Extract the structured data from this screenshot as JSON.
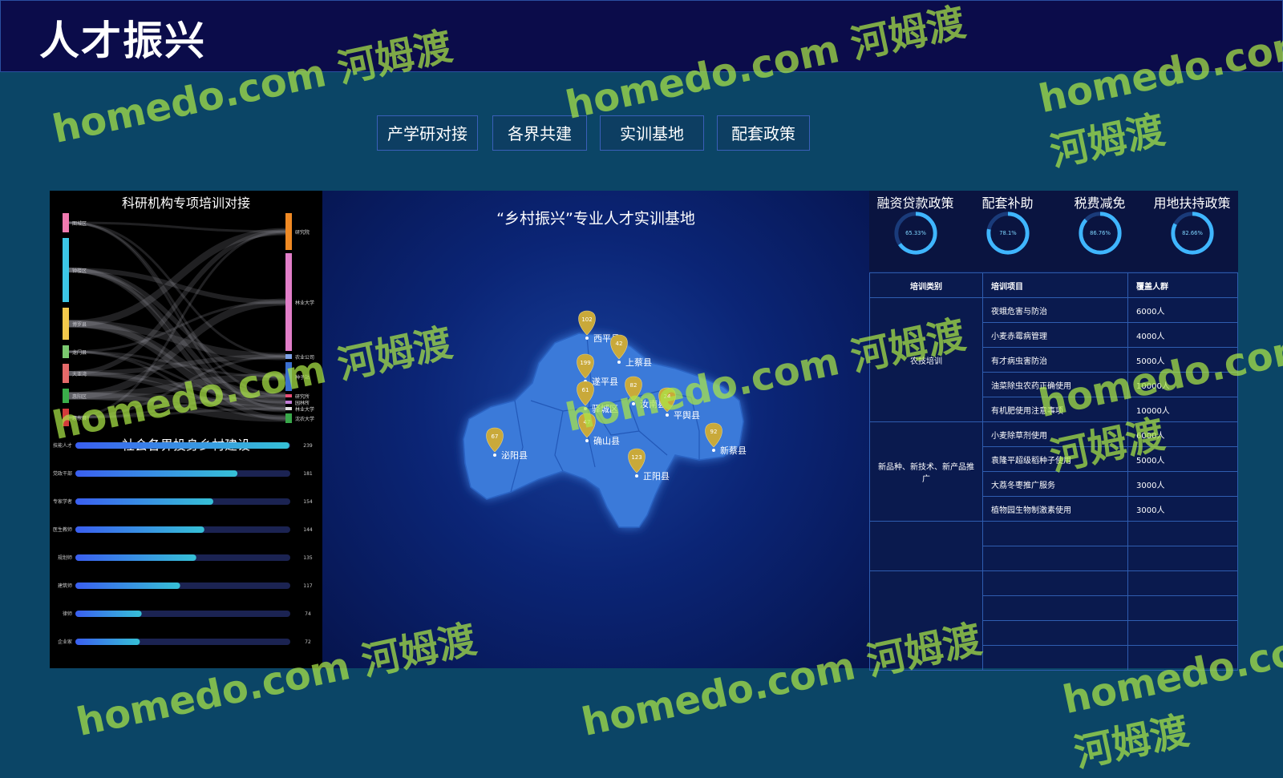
{
  "header": {
    "title": "人才振兴"
  },
  "tabs": [
    {
      "label": "产学研对接"
    },
    {
      "label": "各界共建"
    },
    {
      "label": "实训基地"
    },
    {
      "label": "配套政策"
    }
  ],
  "left": {
    "sankey_title": "科研机构专项培训对接",
    "sankey_left": [
      "图城区",
      "钟楼区",
      "博罗县",
      "龙门县",
      "大亚湾",
      "惠阳区",
      "惠东县"
    ],
    "sankey_right": [
      "研究院",
      "林业大学",
      "农业公司",
      "种子站",
      "研究所",
      "园林所",
      "林业大学",
      "沈农大学"
    ],
    "bars_title": "社会各界投身乡村建设",
    "bars": [
      {
        "label": "技能人才",
        "value": 239
      },
      {
        "label": "党政干部",
        "value": 181
      },
      {
        "label": "专家学者",
        "value": 154
      },
      {
        "label": "医生教师",
        "value": 144
      },
      {
        "label": "规划师",
        "value": 135
      },
      {
        "label": "建筑师",
        "value": 117
      },
      {
        "label": "律师",
        "value": 74
      },
      {
        "label": "企业家",
        "value": 72
      }
    ]
  },
  "map": {
    "title": "“乡村振兴”专业人才实训基地",
    "markers": [
      {
        "name": "西平县",
        "value": "102"
      },
      {
        "name": "上蔡县",
        "value": "42"
      },
      {
        "name": "遂平县",
        "value": "199"
      },
      {
        "name": "驿城区",
        "value": "61"
      },
      {
        "name": "汝南县",
        "value": "82"
      },
      {
        "name": "平舆县",
        "value": "24"
      },
      {
        "name": "确山县",
        "value": "47"
      },
      {
        "name": "泌阳县",
        "value": "67"
      },
      {
        "name": "正阳县",
        "value": "123"
      },
      {
        "name": "新蔡县",
        "value": "92"
      }
    ]
  },
  "policies": [
    {
      "label": "融资贷款政策",
      "value": "65.33%",
      "pct": 65.33
    },
    {
      "label": "配套补助",
      "value": "78.1%",
      "pct": 78.1
    },
    {
      "label": "税费减免",
      "value": "86.76%",
      "pct": 86.76
    },
    {
      "label": "用地扶持政策",
      "value": "82.66%",
      "pct": 82.66
    }
  ],
  "table": {
    "headers": [
      "培训类别",
      "培训项目",
      "覆盖人群"
    ],
    "groups": [
      {
        "category": "农技培训",
        "rows": [
          {
            "item": "夜蛾危害与防治",
            "count": "6000人"
          },
          {
            "item": "小麦赤霉病管理",
            "count": "4000人"
          },
          {
            "item": "有才病虫害防治",
            "count": "5000人"
          },
          {
            "item": "油菜除虫农药正确使用",
            "count": "10000人"
          },
          {
            "item": "有机肥使用注意事项",
            "count": "10000人"
          }
        ]
      },
      {
        "category": "新品种、新技术、新产品推广",
        "rows": [
          {
            "item": "小麦除草剂使用",
            "count": "6000人"
          },
          {
            "item": "袁隆平超级稻种子使用",
            "count": "5000人"
          },
          {
            "item": "大荔冬枣推广服务",
            "count": "3000人"
          },
          {
            "item": "植物园生物制激素使用",
            "count": "3000人"
          }
        ]
      }
    ],
    "empty_rows": 6
  },
  "watermark": {
    "text": "homedo.com 河姆渡"
  },
  "colors": {
    "bg": "#0b4566",
    "header_bg": "#0b0c4a",
    "bar_start": "#3a5ff0",
    "bar_end": "#36c0d6",
    "marker": "#c9a93a",
    "map_region": "#3b7ad9",
    "gauge": "#3fb6ff"
  }
}
